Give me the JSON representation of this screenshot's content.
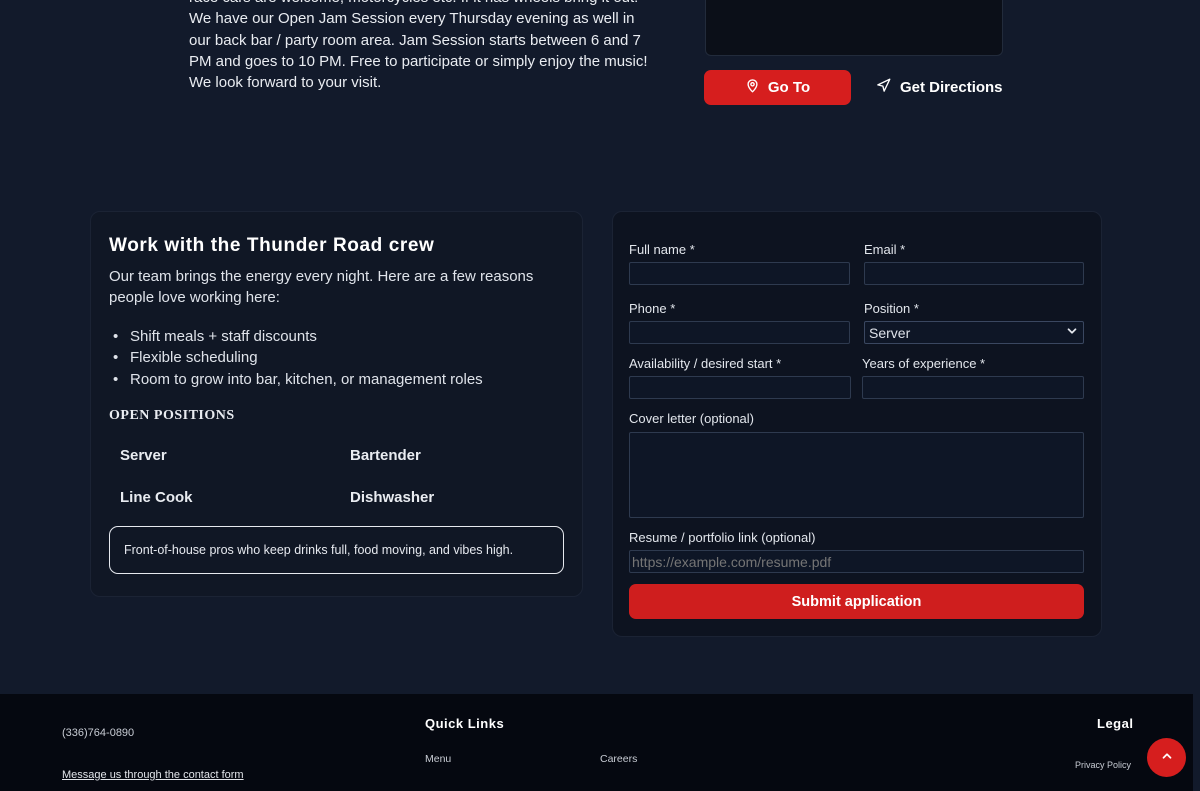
{
  "location": {
    "intro_text": "race cars are welcome, motorcycles etc. If it has wheels bring it out! We have our Open Jam Session every Thursday evening as well in our back bar / party room area. Jam Session starts between 6 and 7 PM and goes to 10 PM. Free to participate or simply enjoy the music! We look forward to your visit.",
    "goto_label": "Go To",
    "directions_label": "Get Directions"
  },
  "jobs": {
    "title": "Work with the Thunder Road crew",
    "description": "Our team brings the energy every night. Here are a few reasons people love working here:",
    "perks": [
      "Shift meals + staff discounts",
      "Flexible scheduling",
      "Room to grow into bar, kitchen, or management roles"
    ],
    "open_positions_title": "OPEN POSITIONS",
    "positions": [
      "Server",
      "Bartender",
      "Line Cook",
      "Dishwasher"
    ],
    "selected_position_desc": "Front-of-house pros who keep drinks full, food moving, and vibes high."
  },
  "form": {
    "full_name_label": "Full name *",
    "email_label": "Email *",
    "phone_label": "Phone *",
    "position_label": "Position *",
    "position_value": "Server",
    "availability_label": "Availability / desired start *",
    "experience_label": "Years of experience *",
    "cover_label": "Cover letter (optional)",
    "resume_label": "Resume / portfolio link (optional)",
    "resume_placeholder": "https://example.com/resume.pdf",
    "submit_label": "Submit application"
  },
  "footer": {
    "phone": "(336)764-0890",
    "message_link": "Message us through the contact form",
    "quick_links_title": "Quick Links",
    "menu_link": "Menu",
    "careers_link": "Careers",
    "legal_title": "Legal",
    "privacy_link": "Privacy Policy"
  },
  "colors": {
    "accent": "#d61e1e",
    "background": "#121a2b",
    "footer_bg": "#050810"
  },
  "icons": {
    "goto": "map-pin-icon",
    "directions": "navigation-arrow-icon",
    "scroll_top": "chevron-up-icon",
    "select": "chevron-down-icon"
  }
}
